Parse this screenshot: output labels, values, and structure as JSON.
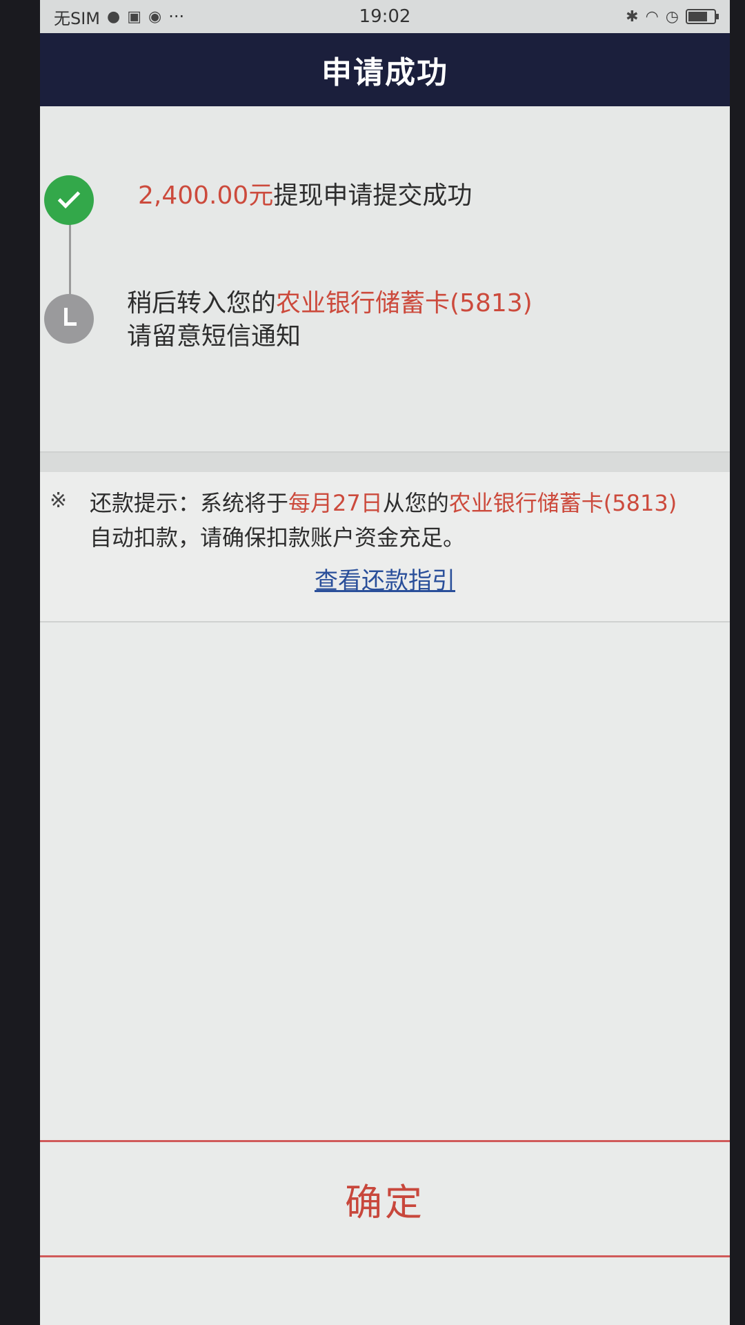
{
  "status_bar": {
    "carrier": "无SIM",
    "extra": "···",
    "time": "19:02",
    "battery_level_percent": 75,
    "icons": [
      "wechat-icon",
      "notification-icon",
      "app-icon",
      "bluetooth-icon",
      "wifi-icon",
      "alarm-icon"
    ]
  },
  "header": {
    "title": "申请成功"
  },
  "steps": [
    {
      "status": "done",
      "icon": "check-icon",
      "amount": "2,400.00元",
      "text": "提现申请提交成功"
    },
    {
      "status": "pending",
      "icon": "clock-icon",
      "prefix": "稍后转入您的",
      "bank": "农业银行储蓄卡(5813)",
      "line2": "请留意短信通知"
    }
  ],
  "notice": {
    "mark": "※",
    "label": "还款提示：系统将于",
    "date": "每月27日",
    "middle": "从您的",
    "bank": "农业银行储蓄卡(5813)",
    "tail": "自动扣款，请确保扣款账户资金充足。",
    "link": "查看还款指引"
  },
  "footer": {
    "confirm_label": "确定"
  },
  "colors": {
    "header_bg": "#1b1f3c",
    "accent_red": "#cc4a3c",
    "success_green": "#33a84a",
    "pending_gray": "#9a9a9c",
    "link_blue": "#2a4f9a"
  }
}
